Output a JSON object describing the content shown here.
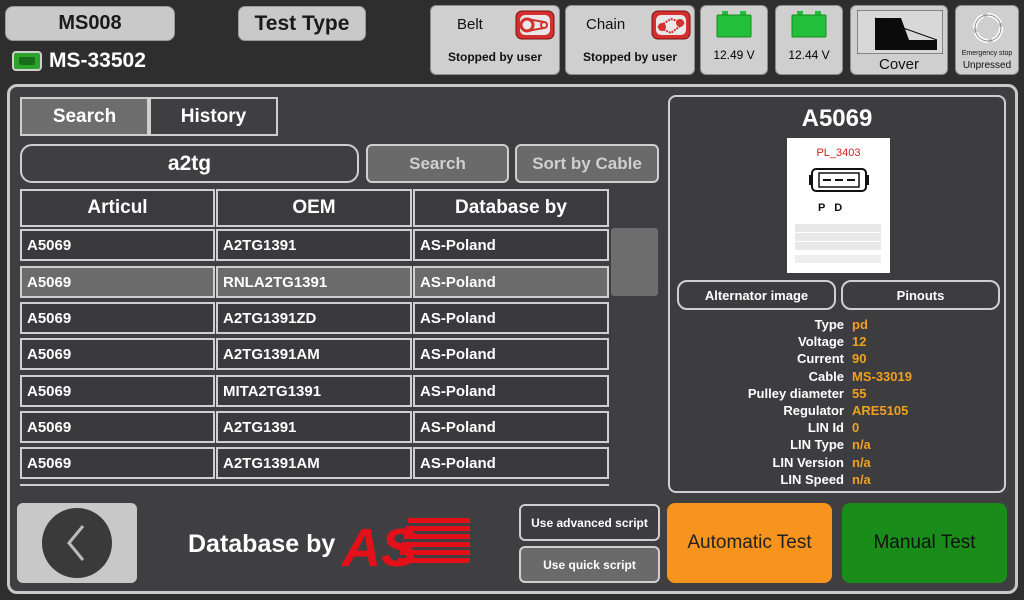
{
  "header": {
    "device_id": "MS008",
    "test_type_label": "Test Type",
    "connection_id": "MS-33502"
  },
  "status_tiles": {
    "belt": {
      "title": "Belt",
      "status": "Stopped by user"
    },
    "chain": {
      "title": "Chain",
      "status": "Stopped by user"
    },
    "battery1": {
      "voltage": "12.49 V"
    },
    "battery2": {
      "voltage": "12.44 V"
    },
    "cover": {
      "label": "Cover"
    },
    "emergency": {
      "title": "Emergency stop",
      "status": "Unpressed"
    }
  },
  "tabs": {
    "search": "Search",
    "history": "History"
  },
  "search": {
    "query": "a2tg",
    "search_button": "Search",
    "sort_button": "Sort by Cable"
  },
  "table": {
    "columns": [
      "Articul",
      "OEM",
      "Database by"
    ],
    "rows": [
      [
        "A5069",
        "A2TG1391",
        "AS-Poland"
      ],
      [
        "A5069",
        "RNLA2TG1391",
        "AS-Poland"
      ],
      [
        "A5069",
        "A2TG1391ZD",
        "AS-Poland"
      ],
      [
        "A5069",
        "A2TG1391AM",
        "AS-Poland"
      ],
      [
        "A5069",
        "MITA2TG1391",
        "AS-Poland"
      ],
      [
        "A5069",
        "A2TG1391",
        "AS-Poland"
      ],
      [
        "A5069",
        "A2TG1391AM",
        "AS-Poland"
      ]
    ],
    "selected_row": 1
  },
  "detail": {
    "title": "A5069",
    "pinout_code": "PL_3403",
    "pinout_pins": "P   D",
    "alternator_image_button": "Alternator image",
    "pinouts_button": "Pinouts",
    "specs": [
      {
        "label": "Type",
        "value": "pd"
      },
      {
        "label": "Voltage",
        "value": "12"
      },
      {
        "label": "Current",
        "value": "90"
      },
      {
        "label": "Cable",
        "value": "MS-33019"
      },
      {
        "label": "Pulley diameter",
        "value": "55"
      },
      {
        "label": "Regulator",
        "value": "ARE5105"
      },
      {
        "label": "LIN Id",
        "value": "0"
      },
      {
        "label": "LIN Type",
        "value": "n/a"
      },
      {
        "label": "LIN Version",
        "value": "n/a"
      },
      {
        "label": "LIN Speed",
        "value": "n/a"
      }
    ]
  },
  "footer": {
    "database_by": "Database by",
    "advanced_script": "Use advanced script",
    "quick_script": "Use quick script",
    "automatic_test": "Automatic Test",
    "manual_test": "Manual Test"
  },
  "colors": {
    "accent_orange": "#f7941d",
    "manual_green": "#1a8c1a",
    "battery_green": "#22c03a",
    "spec_value": "#f0a020",
    "logo_red": "#e3101a"
  },
  "icons": {
    "belt": "belt-icon",
    "chain": "chain-icon",
    "battery": "battery-icon",
    "cover": "cover-icon",
    "emergency": "refresh-icon",
    "back": "chevron-left-icon",
    "connection": "connection-icon"
  }
}
